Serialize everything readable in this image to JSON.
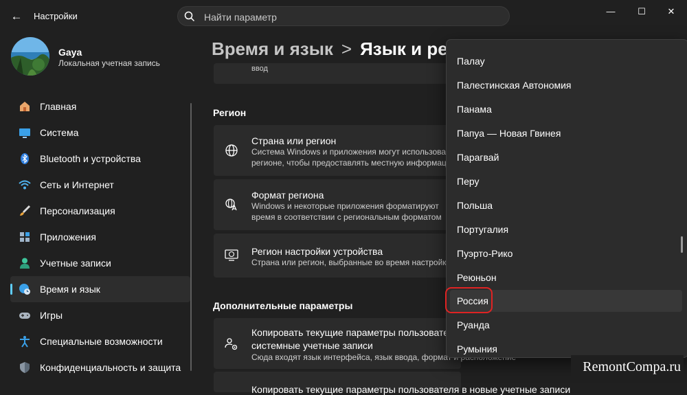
{
  "app": {
    "title": "Настройки"
  },
  "search": {
    "placeholder": "Найти параметр"
  },
  "window_controls": {
    "minimize": "—",
    "maximize": "☐",
    "close": "✕"
  },
  "profile": {
    "name": "Gaya",
    "account_type": "Локальная учетная запись"
  },
  "sidebar": {
    "items": [
      {
        "label": "Главная",
        "icon": "home-icon"
      },
      {
        "label": "Система",
        "icon": "monitor-icon"
      },
      {
        "label": "Bluetooth и устройства",
        "icon": "bluetooth-icon"
      },
      {
        "label": "Сеть и Интернет",
        "icon": "wifi-icon"
      },
      {
        "label": "Персонализация",
        "icon": "brush-icon"
      },
      {
        "label": "Приложения",
        "icon": "apps-icon"
      },
      {
        "label": "Учетные записи",
        "icon": "person-icon"
      },
      {
        "label": "Время и язык",
        "icon": "globe-clock-icon",
        "active": true
      },
      {
        "label": "Игры",
        "icon": "gamepad-icon"
      },
      {
        "label": "Специальные возможности",
        "icon": "accessibility-icon"
      },
      {
        "label": "Конфиденциальность и защита",
        "icon": "shield-icon"
      }
    ]
  },
  "breadcrumb": {
    "parent": "Время и язык",
    "separator": ">",
    "current": "Язык и рег"
  },
  "content": {
    "top_card_fragment": "ввод",
    "region_section": "Регион",
    "cards": [
      {
        "title": "Страна или регион",
        "desc1": "Система Windows и приложения могут использовать ",
        "desc2": "регионе, чтобы предоставлять местную информацию",
        "icon": "globe-icon"
      },
      {
        "title": "Формат региона",
        "desc1": "Windows и некоторые приложения форматируют ",
        "desc2": "время в соответствии с региональным форматом",
        "icon": "format-icon"
      },
      {
        "title": "Регион настройки устройства",
        "desc1": "Страна или регион, выбранные во время настройки ",
        "icon": "globe-monitor-icon"
      }
    ],
    "additional_section": "Дополнительные параметры",
    "copy_card": {
      "title1": "Копировать текущие параметры пользователя",
      "title2": "системные учетные записи",
      "desc": "Сюда входят язык интерфейса, язык ввода, формат и расположение",
      "icon": "people-gear-icon"
    },
    "bottom_fragment": "Копировать текущие параметры пользователя в новые учетные записи"
  },
  "dropdown": {
    "options": [
      "Палау",
      "Палестинская Автономия",
      "Панама",
      "Папуа — Новая Гвинея",
      "Парагвай",
      "Перу",
      "Польша",
      "Португалия",
      "Пуэрто-Рико",
      "Реюньон",
      "Россия",
      "Руанда",
      "Румыния"
    ],
    "selected": "Россия"
  },
  "watermark": "RemontCompa.ru",
  "colors": {
    "accent": "#60cdff",
    "highlight": "#e02323",
    "background": "#202020",
    "card": "#2b2b2b"
  }
}
